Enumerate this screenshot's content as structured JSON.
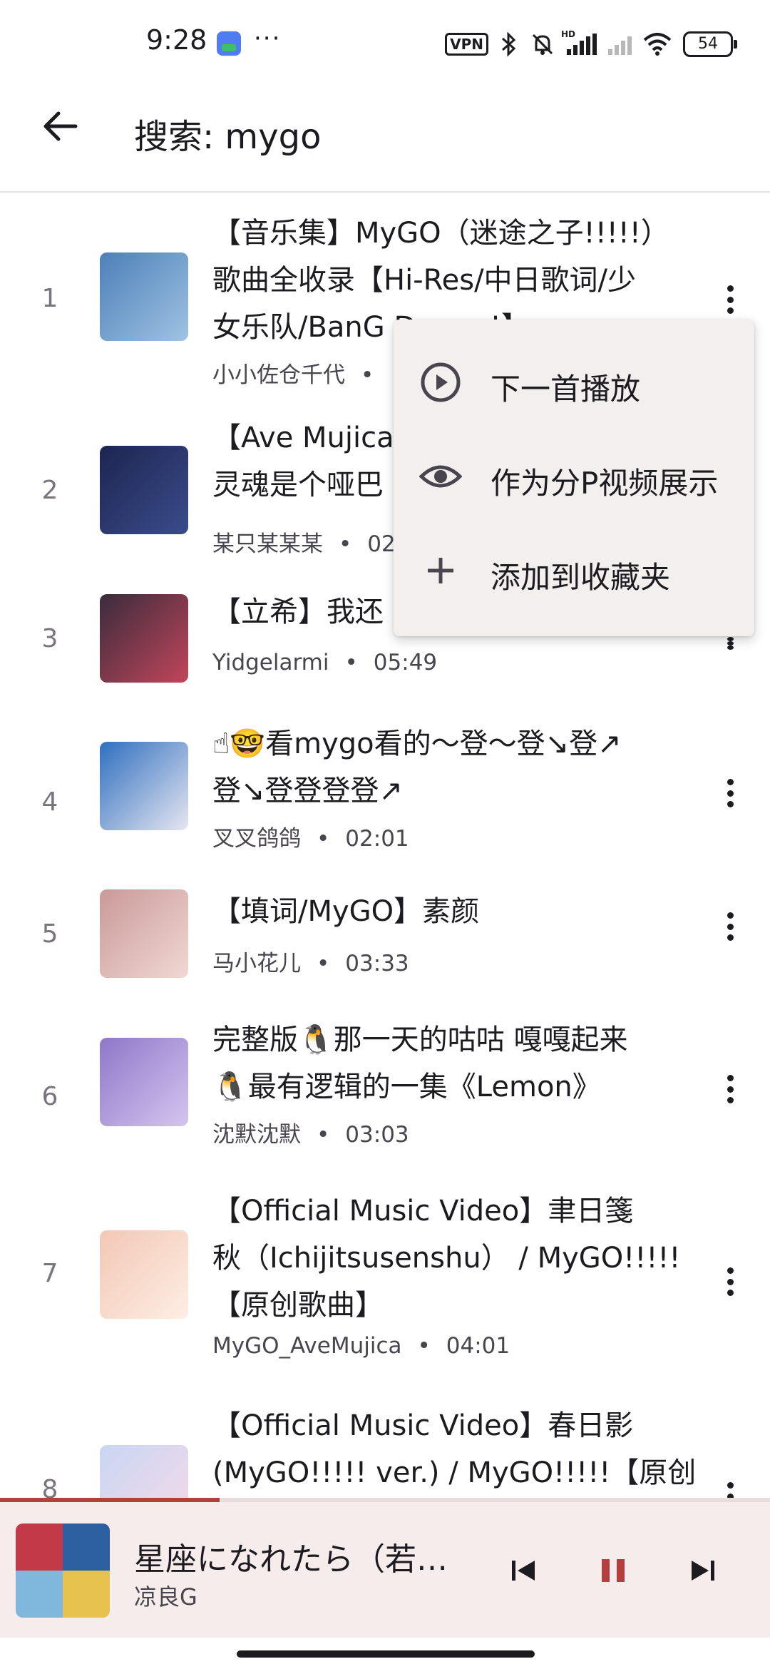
{
  "status_bar": {
    "time": "9:28",
    "more": "···",
    "vpn": "VPN",
    "battery": "54",
    "icons": [
      "app-icon",
      "bluetooth-icon",
      "mute-icon",
      "signal-icon",
      "signal-faint-icon",
      "wifi-icon",
      "battery-icon"
    ]
  },
  "app_bar": {
    "title": "搜索: mygo",
    "back_icon": "arrow-back-icon"
  },
  "results": [
    {
      "index": "1",
      "title": "【音乐集】MyGO（迷途之子!!!!!）\n歌曲全收录【Hi-Res/中日歌词/少\n女乐队/BanG Dream!】",
      "author": "小小佐仓千代",
      "duration": "",
      "thumb": [
        "#4d7fb8",
        "#9fc3e3"
      ]
    },
    {
      "index": "2",
      "title": "【Ave Mujica】你说得对但是\n灵魂是个哑巴",
      "author": "某只某某某",
      "duration": "02:",
      "thumb": [
        "#1d2550",
        "#3b4c8c"
      ]
    },
    {
      "index": "3",
      "title": "【立希】我还",
      "author": "Yidgelarmi",
      "duration": "05:49",
      "thumb": [
        "#3a2c3c",
        "#c2455a"
      ]
    },
    {
      "index": "4",
      "title": "☝🤓看mygo看的～登～登↘登↗\n登↘登登登登↗",
      "author": "叉叉鸽鸽",
      "duration": "02:01",
      "thumb": [
        "#2f6fc0",
        "#e6e6f0"
      ]
    },
    {
      "index": "5",
      "title": "【填词/MyGO】素颜",
      "author": "马小花儿",
      "duration": "03:33",
      "thumb": [
        "#c99a9a",
        "#f1d8d2"
      ]
    },
    {
      "index": "6",
      "title": "完整版🐧那一天的咕咕 嘎嘎起来\n🐧最有逻辑的一集《Lemon》",
      "author": "沈默沈默",
      "duration": "03:03",
      "thumb": [
        "#8d78c8",
        "#d3c5ef"
      ]
    },
    {
      "index": "7",
      "title": "【Official Music Video】聿日箋\n秋（Ichijitsusenshu） / MyGO!!!!!\n【原创歌曲】",
      "author": "MyGO_AveMujica",
      "duration": "04:01",
      "thumb": [
        "#f3c7b5",
        "#fdeee4"
      ]
    },
    {
      "index": "8",
      "title": "【Official Music Video】春日影\n(MyGO!!!!! ver.) / MyGO!!!!!【原创",
      "author": "",
      "duration": "",
      "thumb": [
        "#c9d6f4",
        "#f7d9e8"
      ]
    }
  ],
  "menu": {
    "items": [
      {
        "label": "下一首播放",
        "icon": "play-circle-icon"
      },
      {
        "label": "作为分P视频展示",
        "icon": "eye-icon"
      },
      {
        "label": "添加到收藏夹",
        "icon": "plus-icon"
      }
    ]
  },
  "player": {
    "title": "星座になれたら（若…",
    "artist": "凉良G",
    "progress": 0.285,
    "accent": "#b3403e",
    "controls": [
      "skip-previous-icon",
      "pause-icon",
      "skip-next-icon"
    ]
  }
}
